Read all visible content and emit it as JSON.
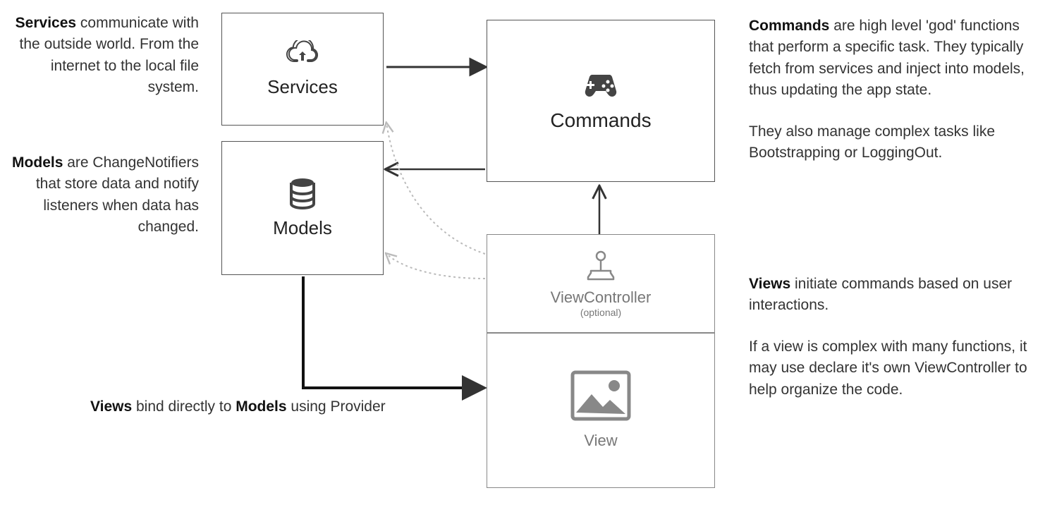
{
  "boxes": {
    "services": {
      "title": "Services"
    },
    "models": {
      "title": "Models"
    },
    "commands": {
      "title": "Commands"
    },
    "viewcontroller": {
      "title": "ViewController",
      "sub": "(optional)"
    },
    "view": {
      "title": "View"
    }
  },
  "descriptions": {
    "services": {
      "bold": "Services",
      "rest": " communicate with the outside world. From the internet to the local file system."
    },
    "models": {
      "bold": "Models",
      "rest": " are ChangeNotifiers that store data and notify listeners when data has changed."
    },
    "commands": {
      "bold": "Commands",
      "rest": " are high level 'god' functions that perform a specific task. They typically fetch from services and inject into models, thus updating the app state.",
      "para2": "They also manage complex tasks like Bootstrapping or LoggingOut."
    },
    "views": {
      "bold1": "Views",
      "rest1": " initiate commands based on user interactions.",
      "para2": "If a view is complex with many functions, it may use declare it's own ViewController to help organize the code."
    },
    "binding": {
      "bold1": "Views",
      "mid": " bind directly to ",
      "bold2": "Models",
      "rest": " using Provider"
    }
  }
}
